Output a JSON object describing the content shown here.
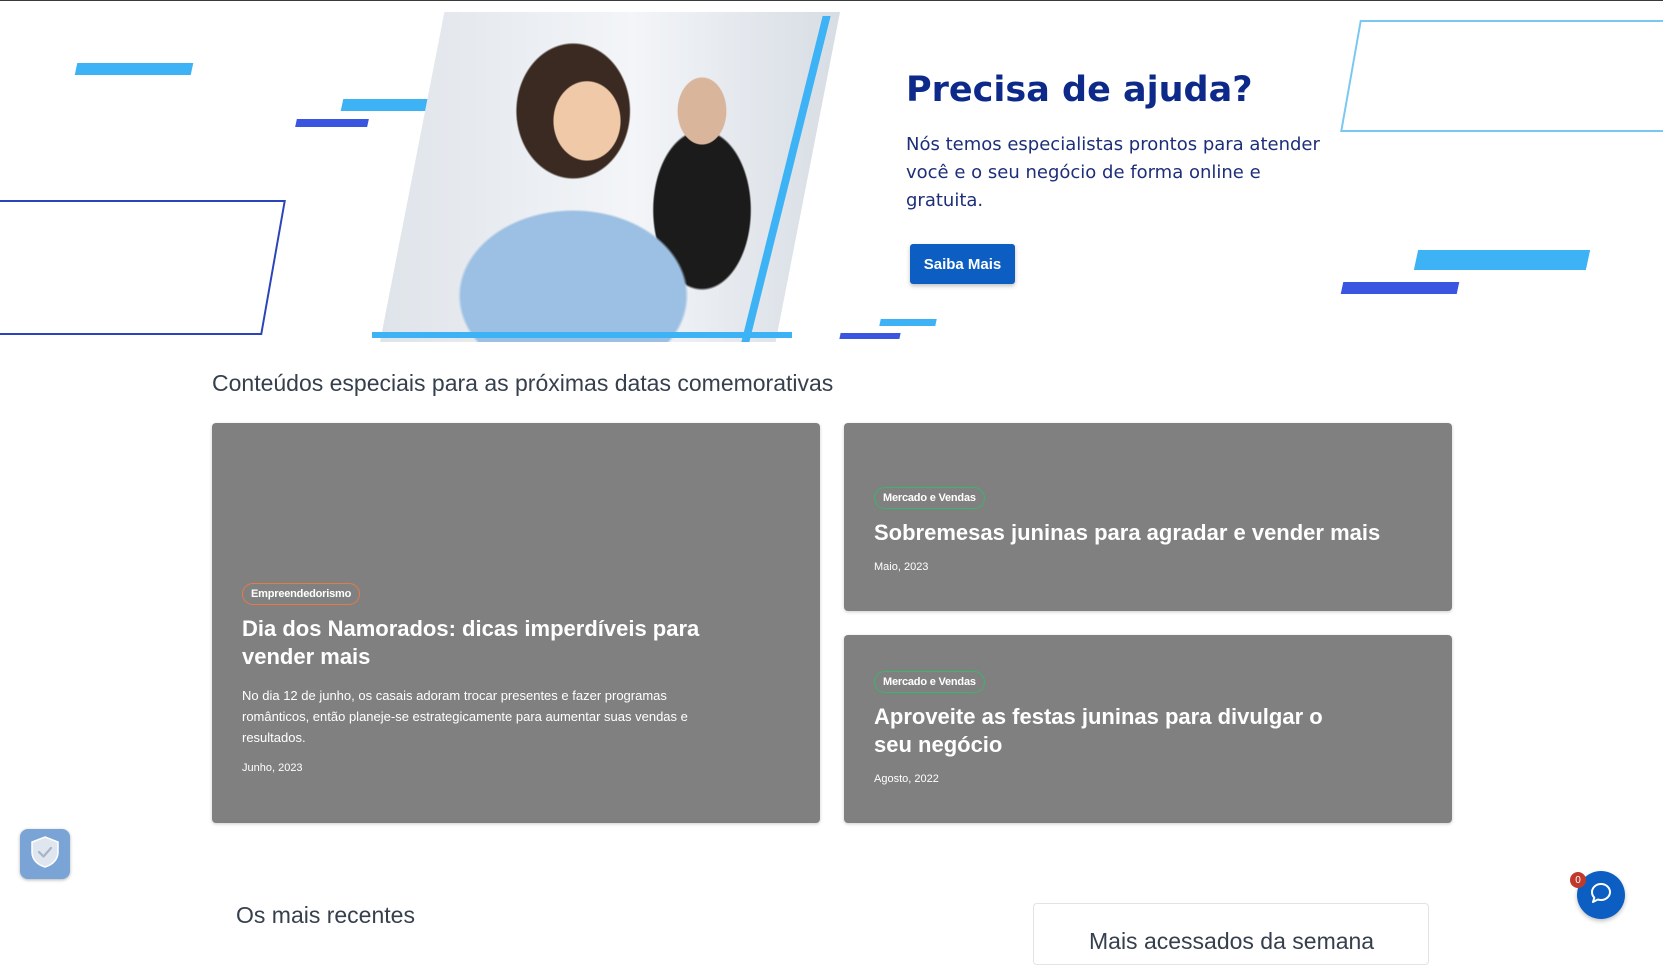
{
  "hero": {
    "title": "Precisa de ajuda?",
    "description": "Nós temos especialistas prontos para atender você e o seu negócio de forma online e gratuita.",
    "button_label": "Saiba Mais"
  },
  "special_section": {
    "title": "Conteúdos especiais para as próximas datas comemorativas",
    "cards": [
      {
        "category": "Empreendedorismo",
        "title": "Dia dos Namorados: dicas imperdíveis para vender mais",
        "description": "No dia 12 de junho, os casais adoram trocar presentes e fazer programas românticos, então planeje-se estrategicamente para aumentar suas vendas e resultados.",
        "date": "Junho, 2023"
      },
      {
        "category": "Mercado e Vendas",
        "title": "Sobremesas juninas para agradar e vender mais",
        "date": "Maio, 2023"
      },
      {
        "category": "Mercado e Vendas",
        "title": "Aproveite as festas juninas para divulgar o seu negócio",
        "date": "Agosto, 2022"
      }
    ]
  },
  "recent": {
    "title": "Os mais recentes"
  },
  "most_accessed": {
    "title": "Mais acessados da semana"
  },
  "chat": {
    "unread_count": "0"
  },
  "colors": {
    "primary": "#0d5ec2",
    "navy": "#0d2a8a",
    "light_blue": "#3db2f5",
    "card_bg": "#808080"
  },
  "icons": {
    "privacy": "shield-check-icon",
    "chat": "chat-bubble-icon"
  }
}
